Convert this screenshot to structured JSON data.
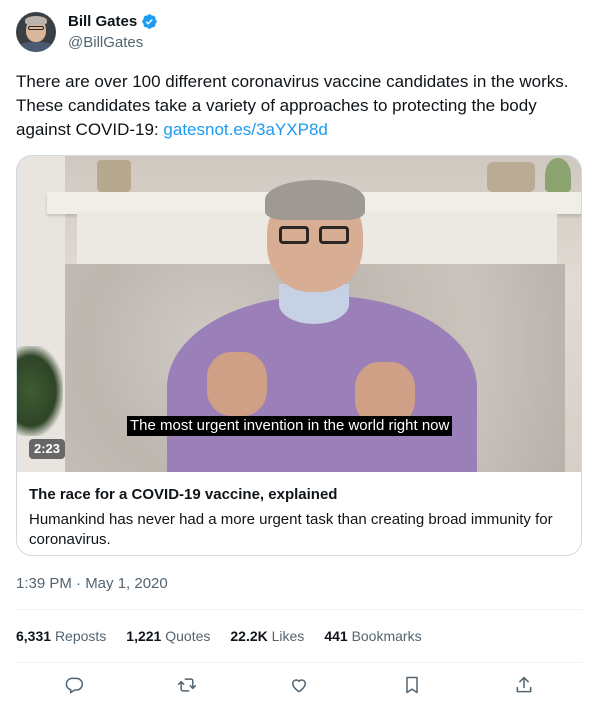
{
  "author": {
    "name": "Bill Gates",
    "handle": "@BillGates",
    "verified": true
  },
  "tweet": {
    "text": "There are over 100 different coronavirus vaccine candidates in the works. These candidates take a variety of approaches to protecting the body against COVID-19: ",
    "link_text": "gatesnot.es/3aYXP8d"
  },
  "media": {
    "subtitle": "The most urgent invention in the world right now",
    "duration": "2:23",
    "card_title": "The race for a COVID-19 vaccine, explained",
    "card_description": "Humankind has never had a more urgent task than creating broad immunity for coronavirus."
  },
  "timestamp": "1:39 PM · May 1, 2020",
  "stats": {
    "reposts_count": "6,331",
    "reposts_label": "Reposts",
    "quotes_count": "1,221",
    "quotes_label": "Quotes",
    "likes_count": "22.2K",
    "likes_label": "Likes",
    "bookmarks_count": "441",
    "bookmarks_label": "Bookmarks"
  },
  "actions": [
    "reply-icon",
    "repost-icon",
    "like-icon",
    "bookmark-icon",
    "share-icon"
  ],
  "colors": {
    "link": "#1d9bf0",
    "verified": "#1d9bf0",
    "secondary_text": "#536471",
    "border": "#cfd9de"
  }
}
